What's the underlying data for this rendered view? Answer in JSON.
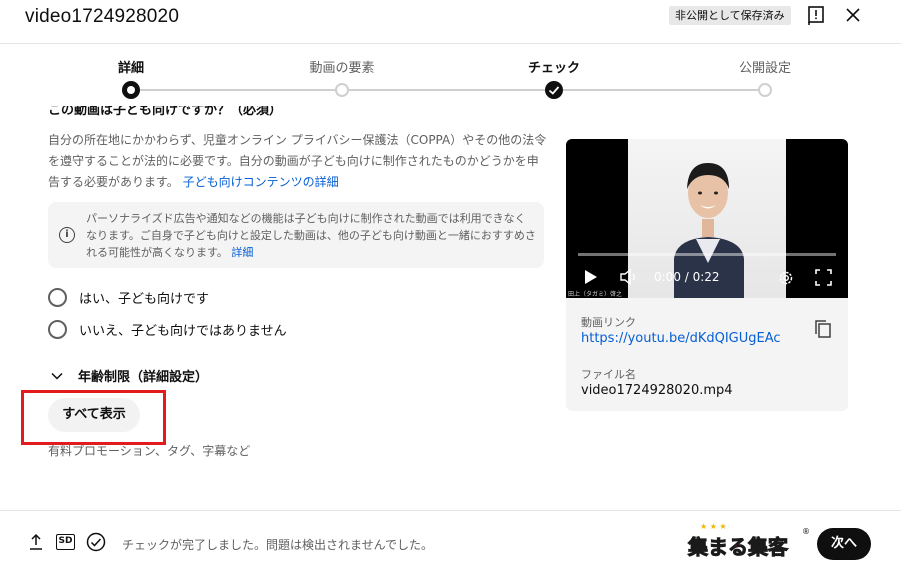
{
  "header": {
    "title": "video1724928020",
    "saved_badge": "非公開として保存済み",
    "alert_icon": "alert-flag-icon",
    "close_icon": "close-icon"
  },
  "stepper": {
    "steps": [
      {
        "label": "詳細",
        "state": "current"
      },
      {
        "label": "動画の要素",
        "state": "todo"
      },
      {
        "label": "チェック",
        "state": "done"
      },
      {
        "label": "公開設定",
        "state": "todo"
      }
    ]
  },
  "main": {
    "cut_heading": "この動画は子ども向けですか？（必須）",
    "desc_text": "自分の所在地にかかわらず、児童オンライン プライバシー保護法（COPPA）やその他の法令を遵守することが法的に必要です。自分の動画が子ども向けに制作されたものかどうかを申告する必要があります。",
    "desc_link": "子ども向けコンテンツの詳細",
    "info_text": "パーソナライズド広告や通知などの機能は子ども向けに制作された動画では利用できなくなります。ご自身で子ども向けと設定した動画は、他の子ども向け動画と一緒におすすめされる可能性が高くなります。",
    "info_link": "詳細",
    "radio_yes": "はい、子ども向けです",
    "radio_no": "いいえ、子ども向けではありません",
    "age_restriction": "年齢制限（詳細設定）",
    "show_all_button": "すべて表示",
    "show_all_sub": "有料プロモーション、タグ、字幕など"
  },
  "preview": {
    "time": "0:00 / 0:22",
    "credit": "田上（タガミ）啓之",
    "link_label": "動画リンク",
    "link_value": "https://youtu.be/dKdQIGUgEAc",
    "file_label": "ファイル名",
    "file_value": "video1724928020.mp4"
  },
  "footer": {
    "status_text": "チェックが完了しました。問題は検出されませんでした。",
    "logo_text": "集まる集客",
    "next_button": "次へ",
    "hd_badge": "SD"
  },
  "colors": {
    "accent_link": "#065fd4",
    "highlight_red": "#e21c1c",
    "logo_pink": "#e5007f"
  }
}
